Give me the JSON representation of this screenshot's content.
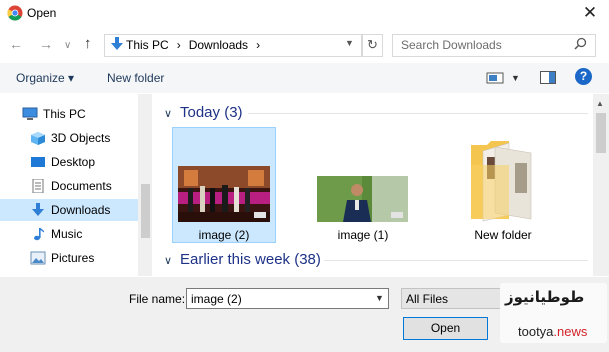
{
  "window": {
    "title": "Open",
    "close_glyph": "✕"
  },
  "nav": {
    "back": "←",
    "forward": "→",
    "recent": "∨",
    "up": "↑",
    "breadcrumb": [
      "This PC",
      "›",
      "Downloads",
      "›"
    ],
    "refresh_glyph": "↻",
    "search_placeholder": "Search Downloads"
  },
  "toolbar": {
    "organize_label": "Organize ▾",
    "new_folder_label": "New folder",
    "help_label": "?"
  },
  "sidebar": {
    "items": [
      {
        "label": "This PC",
        "icon": "pc-icon"
      },
      {
        "label": "3D Objects",
        "icon": "cube-icon"
      },
      {
        "label": "Desktop",
        "icon": "desktop-icon"
      },
      {
        "label": "Documents",
        "icon": "documents-icon"
      },
      {
        "label": "Downloads",
        "icon": "download-icon",
        "selected": true
      },
      {
        "label": "Music",
        "icon": "music-icon"
      },
      {
        "label": "Pictures",
        "icon": "pictures-icon"
      }
    ]
  },
  "content": {
    "groups": [
      {
        "title": "Today (3)",
        "caret": "∨"
      },
      {
        "title": "Earlier this week (38)",
        "caret": "∨"
      }
    ],
    "files": [
      {
        "name": "image (2)",
        "type": "image",
        "selected": true
      },
      {
        "name": "image (1)",
        "type": "image"
      },
      {
        "name": "New folder",
        "type": "folder"
      }
    ]
  },
  "footer": {
    "file_name_label": "File name:",
    "file_name_value": "image (2)",
    "filter_value": "All Files",
    "open_label": "Open"
  },
  "watermark": {
    "logo_text": "طوطیانیوز",
    "url_main": "tootya",
    "url_tld": ".news"
  },
  "colors": {
    "accent": "#0078d7",
    "selection": "#cce8ff",
    "group_title": "#1e3287",
    "help": "#1b68c8"
  }
}
